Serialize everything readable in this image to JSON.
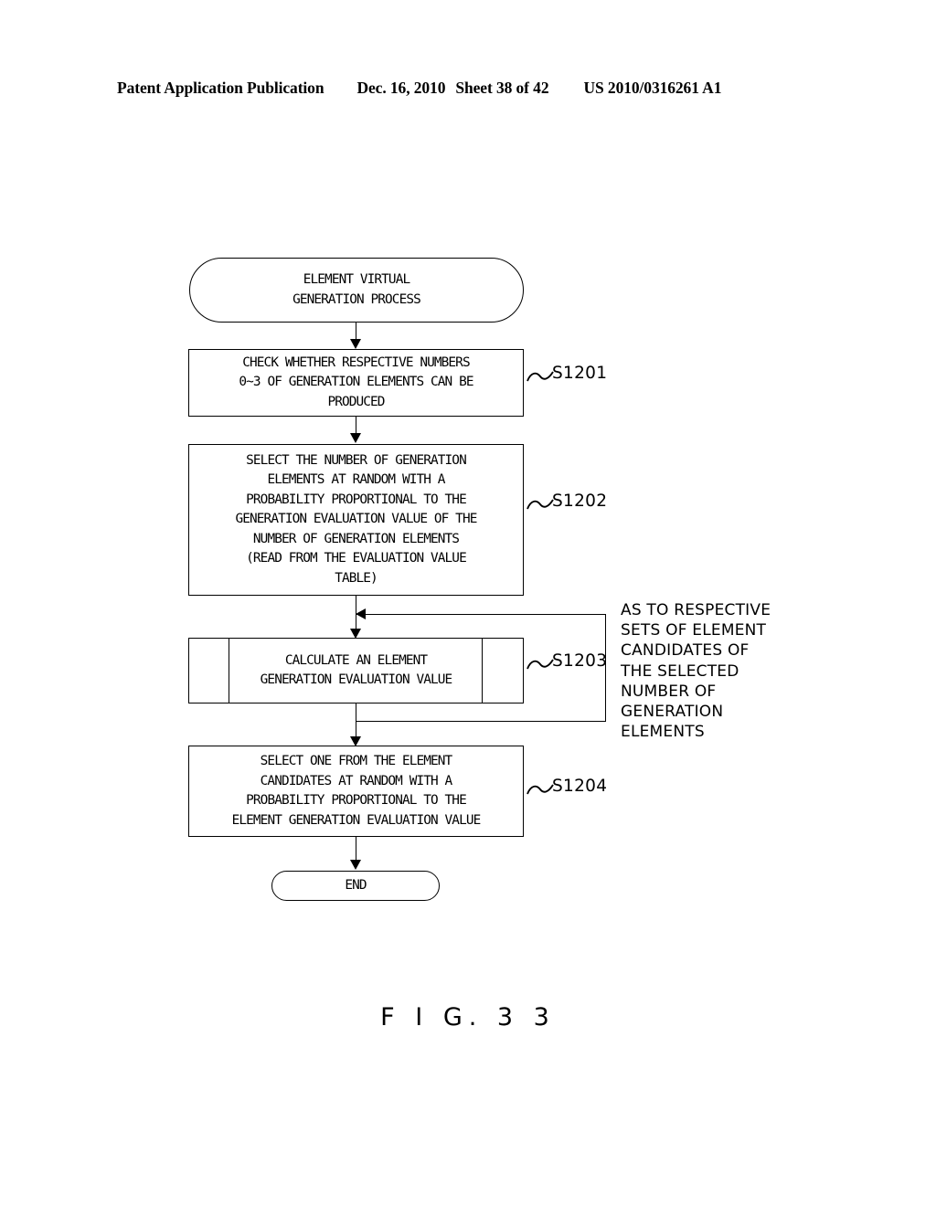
{
  "header": {
    "publication": "Patent Application Publication",
    "date": "Dec. 16, 2010",
    "sheet": "Sheet 38 of 42",
    "pub_number": "US 2010/0316261 A1"
  },
  "figure": {
    "caption": "F I G.  3 3"
  },
  "flowchart": {
    "start": {
      "label_line1": "ELEMENT VIRTUAL",
      "label_line2": "GENERATION PROCESS"
    },
    "steps": [
      {
        "id": "S1201",
        "shape": "process",
        "lines": [
          "CHECK WHETHER RESPECTIVE NUMBERS",
          "0~3 OF GENERATION ELEMENTS CAN BE",
          "PRODUCED"
        ]
      },
      {
        "id": "S1202",
        "shape": "process",
        "lines": [
          "SELECT THE NUMBER OF GENERATION",
          "ELEMENTS AT RANDOM WITH A",
          "PROBABILITY PROPORTIONAL TO THE",
          "GENERATION EVALUATION VALUE OF THE",
          "NUMBER OF GENERATION ELEMENTS",
          "(READ FROM THE EVALUATION VALUE",
          "TABLE)"
        ]
      },
      {
        "id": "S1203",
        "shape": "predefined-process",
        "lines": [
          "CALCULATE AN ELEMENT",
          "GENERATION EVALUATION VALUE"
        ]
      },
      {
        "id": "S1204",
        "shape": "process",
        "lines": [
          "SELECT ONE FROM THE ELEMENT",
          "CANDIDATES AT RANDOM WITH A",
          "PROBABILITY PROPORTIONAL TO THE",
          "ELEMENT GENERATION EVALUATION VALUE"
        ]
      }
    ],
    "end": {
      "label": "END"
    },
    "annotation": {
      "lines": [
        "AS TO RESPECTIVE",
        "SETS OF ELEMENT",
        "CANDIDATES OF",
        "THE SELECTED",
        "NUMBER OF",
        "GENERATION",
        "ELEMENTS"
      ]
    }
  },
  "colors": {
    "ink": "#000000",
    "paper": "#ffffff"
  }
}
